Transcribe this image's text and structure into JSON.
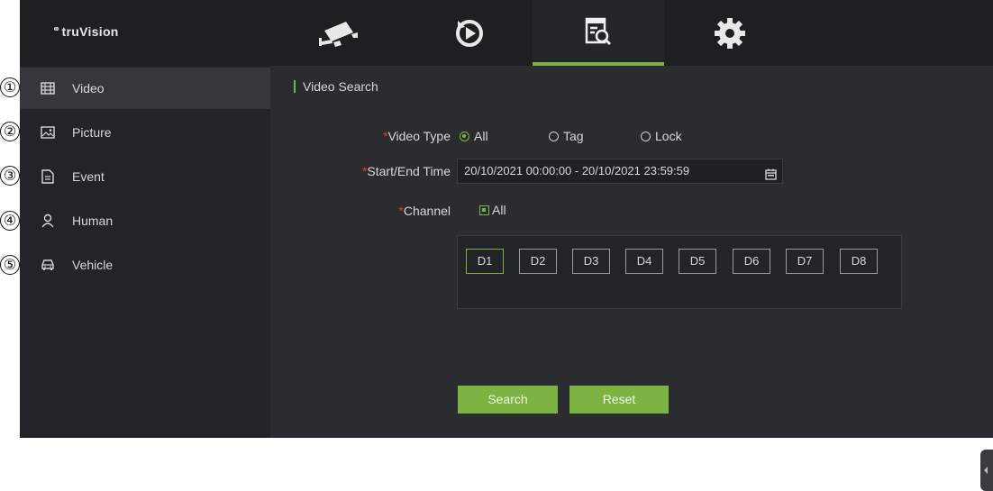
{
  "callouts": [
    "①",
    "②",
    "③",
    "④",
    "⑤"
  ],
  "header": {
    "logo": "truVision",
    "tabs": [
      {
        "icon": "camera-icon",
        "active": false
      },
      {
        "icon": "playback-icon",
        "active": false
      },
      {
        "icon": "search-icon",
        "active": true
      },
      {
        "icon": "gear-icon",
        "active": false
      }
    ]
  },
  "sidebar": {
    "items": [
      {
        "label": "Video",
        "icon": "film-icon",
        "active": true
      },
      {
        "label": "Picture",
        "icon": "image-icon",
        "active": false
      },
      {
        "label": "Event",
        "icon": "document-icon",
        "active": false
      },
      {
        "label": "Human",
        "icon": "person-icon",
        "active": false
      },
      {
        "label": "Vehicle",
        "icon": "car-icon",
        "active": false
      }
    ]
  },
  "main": {
    "section_title": "Video Search",
    "video_type": {
      "label": "Video Type",
      "options": [
        "All",
        "Tag",
        "Lock"
      ],
      "selected": "All"
    },
    "time": {
      "label": "Start/End Time",
      "value": "20/10/2021 00:00:00 - 20/10/2021 23:59:59"
    },
    "channel": {
      "label": "Channel",
      "all_label": "All",
      "channels": [
        "D1",
        "D2",
        "D3",
        "D4",
        "D5",
        "D6",
        "D7",
        "D8"
      ],
      "selected": "D1"
    },
    "search_label": "Search",
    "reset_label": "Reset"
  },
  "colors": {
    "accent": "#7cb342",
    "required": "#e53935",
    "background": "#2b2c2f",
    "topbar": "#1e1f21"
  }
}
